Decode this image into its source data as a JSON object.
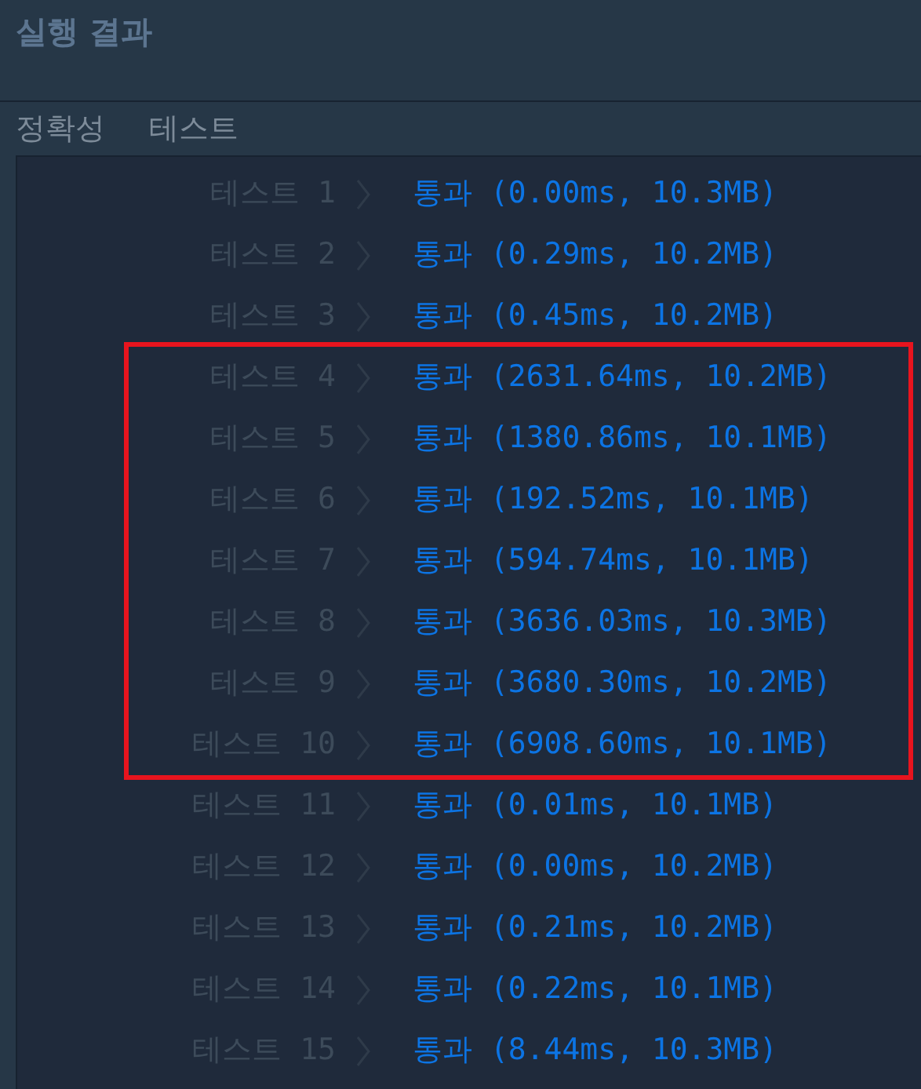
{
  "header": {
    "title": "실행 결과"
  },
  "section_heading": [
    "정확성",
    "테스트"
  ],
  "result_groups": [
    {
      "kind": "plain",
      "rows": [
        {
          "label": "테스트 1",
          "result": "통과 (0.00ms, 10.3MB)"
        },
        {
          "label": "테스트 2",
          "result": "통과 (0.29ms, 10.2MB)"
        },
        {
          "label": "테스트 3",
          "result": "통과 (0.45ms, 10.2MB)"
        }
      ]
    },
    {
      "kind": "framed",
      "rows": [
        {
          "label": "테스트 4",
          "result": "통과 (2631.64ms, 10.2MB)"
        },
        {
          "label": "테스트 5",
          "result": "통과 (1380.86ms, 10.1MB)"
        },
        {
          "label": "테스트 6",
          "result": "통과 (192.52ms, 10.1MB)"
        },
        {
          "label": "테스트 7",
          "result": "통과 (594.74ms, 10.1MB)"
        },
        {
          "label": "테스트 8",
          "result": "통과 (3636.03ms, 10.3MB)"
        },
        {
          "label": "테스트 9",
          "result": "통과 (3680.30ms, 10.2MB)"
        },
        {
          "label": "테스트 10",
          "result": "통과 (6908.60ms, 10.1MB)"
        }
      ]
    },
    {
      "kind": "plain",
      "rows": [
        {
          "label": "테스트 11",
          "result": "통과 (0.01ms, 10.1MB)"
        },
        {
          "label": "테스트 12",
          "result": "통과 (0.00ms, 10.2MB)"
        },
        {
          "label": "테스트 13",
          "result": "통과 (0.21ms, 10.2MB)"
        },
        {
          "label": "테스트 14",
          "result": "통과 (0.22ms, 10.1MB)"
        },
        {
          "label": "테스트 15",
          "result": "통과 (8.44ms, 10.3MB)"
        }
      ]
    }
  ]
}
